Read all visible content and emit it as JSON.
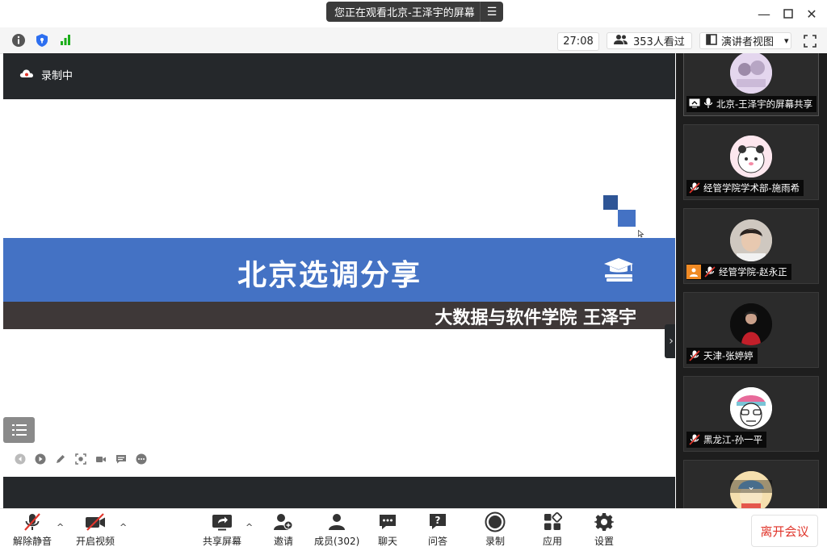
{
  "titlebar": {
    "share_notice": "您正在观看北京-王泽宇的屏幕",
    "menu_glyph": "☰",
    "minimize_glyph": "—",
    "maximize_glyph": "☐",
    "close_glyph": "✕"
  },
  "infobar": {
    "timer": "27:08",
    "viewers": "353人看过",
    "view_mode": "演讲者视图",
    "view_mode_caret": "▾"
  },
  "stage": {
    "recording_label": "录制中",
    "slide_title": "北京选调分享",
    "slide_subtitle": "大数据与软件学院 王泽宇",
    "collapse_glyph": "›"
  },
  "gallery": {
    "participants": [
      {
        "name": "北京-王泽宇的屏幕共享",
        "muted": false,
        "sharing": true
      },
      {
        "name": "经管学院学术部-施雨希",
        "muted": true
      },
      {
        "name": "经管学院-赵永正",
        "muted": true,
        "host_badge": true
      },
      {
        "name": "天津-张婷婷",
        "muted": true
      },
      {
        "name": "黑龙江-孙一平",
        "muted": true
      },
      {
        "name": "",
        "muted": true
      }
    ]
  },
  "toolbar": {
    "unmute": "解除静音",
    "start_video": "开启视频",
    "share_screen": "共享屏幕",
    "invite": "邀请",
    "members": "成员(302)",
    "chat": "聊天",
    "qa": "问答",
    "record": "录制",
    "apps": "应用",
    "settings": "设置",
    "leave": "离开会议",
    "caret_glyph": "^"
  },
  "colors": {
    "banner_blue": "#4472c4",
    "dark_band": "#3e3838",
    "stage_dark": "#25282b",
    "leave_red": "#e0352b"
  }
}
